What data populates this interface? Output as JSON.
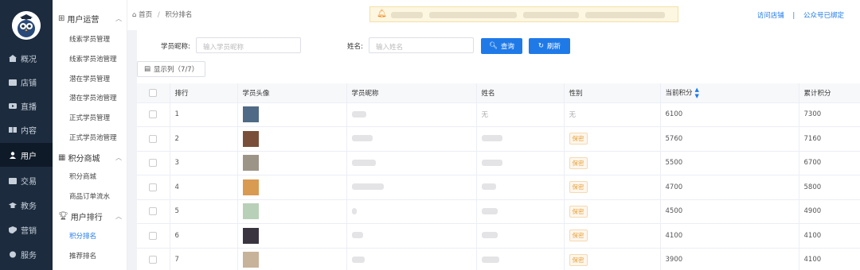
{
  "nav": {
    "items": [
      {
        "label": "概况",
        "icon": "home-icon"
      },
      {
        "label": "店铺",
        "icon": "shop-icon"
      },
      {
        "label": "直播",
        "icon": "live-icon"
      },
      {
        "label": "内容",
        "icon": "book-icon"
      },
      {
        "label": "用户",
        "icon": "user-icon"
      },
      {
        "label": "交易",
        "icon": "wallet-icon"
      },
      {
        "label": "教务",
        "icon": "graduation-icon"
      },
      {
        "label": "营销",
        "icon": "marketing-icon"
      },
      {
        "label": "服务",
        "icon": "service-icon"
      }
    ]
  },
  "submenu": {
    "groups": [
      {
        "title": "用户运营",
        "icon": "grid-icon",
        "items": [
          "线索学员管理",
          "线索学员池管理",
          "潜在学员管理",
          "潜在学员池管理",
          "正式学员管理",
          "正式学员池管理"
        ]
      },
      {
        "title": "积分商城",
        "icon": "store-icon",
        "items": [
          "积分商城",
          "商品订单流水"
        ]
      },
      {
        "title": "用户排行",
        "icon": "trophy-icon",
        "items": [
          "积分排名",
          "推荐排名"
        ]
      }
    ],
    "active": "积分排名"
  },
  "header": {
    "home": "首页",
    "separator": "/",
    "current": "积分排名",
    "visit_store": "访问店铺",
    "divider": "|",
    "official_account": "公众号已绑定"
  },
  "filters": {
    "nickname_label": "学员昵称:",
    "nickname_placeholder": "输入学员昵称",
    "name_label": "姓名:",
    "name_placeholder": "输入姓名",
    "search_label": "查询",
    "refresh_label": "刷新",
    "columns_label": "显示列（7/7）"
  },
  "table": {
    "headers": [
      "排行",
      "学员头像",
      "学员昵称",
      "姓名",
      "性别",
      "当前积分",
      "累计积分"
    ],
    "rows": [
      {
        "rank": "1",
        "name": "无",
        "gender": "无",
        "current": "6100",
        "total": "7300",
        "avatar": "#4f6a86"
      },
      {
        "rank": "2",
        "name": "",
        "gender": "保密",
        "current": "5760",
        "total": "7160",
        "avatar": "#7a4f3a"
      },
      {
        "rank": "3",
        "name": "",
        "gender": "保密",
        "current": "5500",
        "total": "6700",
        "avatar": "#9d9488"
      },
      {
        "rank": "4",
        "name": "",
        "gender": "保密",
        "current": "4700",
        "total": "5800",
        "avatar": "#d99a52"
      },
      {
        "rank": "5",
        "name": "",
        "gender": "保密",
        "current": "4500",
        "total": "4900",
        "avatar": "#b8d0b8"
      },
      {
        "rank": "6",
        "name": "",
        "gender": "保密",
        "current": "4100",
        "total": "4100",
        "avatar": "#3a3440"
      },
      {
        "rank": "7",
        "name": "",
        "gender": "保密",
        "current": "3900",
        "total": "4100",
        "avatar": "#c7b39a"
      }
    ]
  },
  "colors": {
    "accent": "#1f7ae8",
    "nav_bg": "#1c2b3e",
    "tag": "#e6a23c"
  }
}
